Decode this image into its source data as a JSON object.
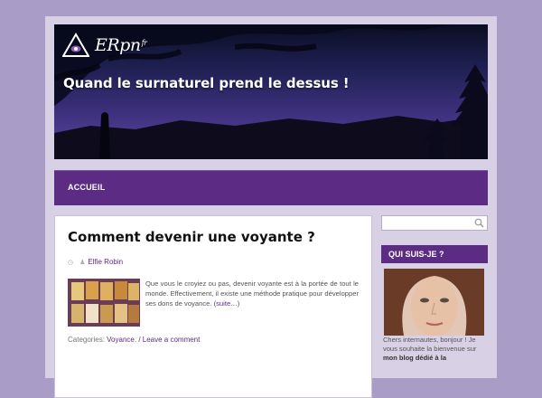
{
  "site": {
    "logo_text": "ERpn",
    "logo_suffix": "fr",
    "tagline": "Quand le surnaturel prend le dessus !"
  },
  "nav": {
    "items": [
      {
        "label": "ACCUEIL"
      }
    ]
  },
  "post": {
    "title": "Comment devenir une voyante ?",
    "author": "Elfie Robin",
    "excerpt": "Que vous le croyiez ou pas, devenir voyante est à la portée de tout le monde. Effectivement, il existe une méthode pratique pour développer ses dons de voyance.",
    "read_more": "(suite…)",
    "categories_label": "Categories:",
    "category": "Voyance.",
    "comment_link": "/ Leave a comment"
  },
  "sidebar": {
    "search_placeholder": "",
    "widget_title": "QUI SUIS-JE ?",
    "about_text_1": "Chers internautes, bonjour ! Je vous souhaite la bienvenue sur",
    "about_text_bold": "mon blog dédié à la"
  },
  "colors": {
    "accent": "#5c2c84",
    "background": "#a99cc7"
  },
  "icons": {
    "logo": "eye-triangle-icon",
    "search": "search-icon",
    "clock": "clock-icon",
    "author": "user-icon"
  }
}
